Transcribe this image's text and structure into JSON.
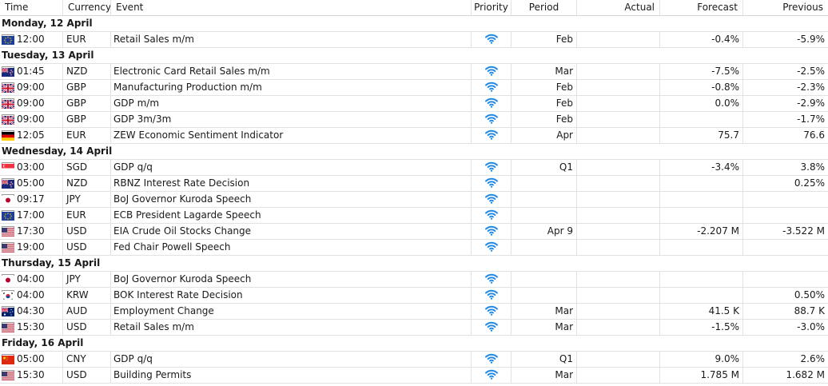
{
  "columns": {
    "time": "Time",
    "currency": "Currency",
    "event": "Event",
    "priority": "Priority",
    "period": "Period",
    "actual": "Actual",
    "forecast": "Forecast",
    "previous": "Previous"
  },
  "icon": "wifi-signal-priority-icon",
  "priority_color": "#1e88e5",
  "days": [
    {
      "label": "Monday, 12 April",
      "events": [
        {
          "time": "12:00",
          "flag": "eu",
          "currency": "EUR",
          "event": "Retail Sales m/m",
          "period": "Feb",
          "actual": "",
          "forecast": "-0.4%",
          "previous": "-5.9%"
        }
      ]
    },
    {
      "label": "Tuesday, 13 April",
      "events": [
        {
          "time": "01:45",
          "flag": "nz",
          "currency": "NZD",
          "event": "Electronic Card Retail Sales m/m",
          "period": "Mar",
          "actual": "",
          "forecast": "-7.5%",
          "previous": "-2.5%"
        },
        {
          "time": "09:00",
          "flag": "gb",
          "currency": "GBP",
          "event": "Manufacturing Production m/m",
          "period": "Feb",
          "actual": "",
          "forecast": "-0.8%",
          "previous": "-2.3%"
        },
        {
          "time": "09:00",
          "flag": "gb",
          "currency": "GBP",
          "event": "GDP m/m",
          "period": "Feb",
          "actual": "",
          "forecast": "0.0%",
          "previous": "-2.9%"
        },
        {
          "time": "09:00",
          "flag": "gb",
          "currency": "GBP",
          "event": "GDP 3m/3m",
          "period": "Feb",
          "actual": "",
          "forecast": "",
          "previous": "-1.7%"
        },
        {
          "time": "12:05",
          "flag": "de",
          "currency": "EUR",
          "event": "ZEW Economic Sentiment Indicator",
          "period": "Apr",
          "actual": "",
          "forecast": "75.7",
          "previous": "76.6"
        }
      ]
    },
    {
      "label": "Wednesday, 14 April",
      "events": [
        {
          "time": "03:00",
          "flag": "sg",
          "currency": "SGD",
          "event": "GDP q/q",
          "period": "Q1",
          "actual": "",
          "forecast": "-3.4%",
          "previous": "3.8%"
        },
        {
          "time": "05:00",
          "flag": "nz",
          "currency": "NZD",
          "event": "RBNZ Interest Rate Decision",
          "period": "",
          "actual": "",
          "forecast": "",
          "previous": "0.25%"
        },
        {
          "time": "09:17",
          "flag": "jp",
          "currency": "JPY",
          "event": "BoJ Governor Kuroda Speech",
          "period": "",
          "actual": "",
          "forecast": "",
          "previous": ""
        },
        {
          "time": "17:00",
          "flag": "eu",
          "currency": "EUR",
          "event": "ECB President Lagarde Speech",
          "period": "",
          "actual": "",
          "forecast": "",
          "previous": ""
        },
        {
          "time": "17:30",
          "flag": "us",
          "currency": "USD",
          "event": "EIA Crude Oil Stocks Change",
          "period": "Apr 9",
          "actual": "",
          "forecast": "-2.207 M",
          "previous": "-3.522 M"
        },
        {
          "time": "19:00",
          "flag": "us",
          "currency": "USD",
          "event": "Fed Chair Powell Speech",
          "period": "",
          "actual": "",
          "forecast": "",
          "previous": ""
        }
      ]
    },
    {
      "label": "Thursday, 15 April",
      "events": [
        {
          "time": "04:00",
          "flag": "jp",
          "currency": "JPY",
          "event": "BoJ Governor Kuroda Speech",
          "period": "",
          "actual": "",
          "forecast": "",
          "previous": ""
        },
        {
          "time": "04:00",
          "flag": "kr",
          "currency": "KRW",
          "event": "BOK Interest Rate Decision",
          "period": "",
          "actual": "",
          "forecast": "",
          "previous": "0.50%"
        },
        {
          "time": "04:30",
          "flag": "au",
          "currency": "AUD",
          "event": "Employment Change",
          "period": "Mar",
          "actual": "",
          "forecast": "41.5 K",
          "previous": "88.7 K"
        },
        {
          "time": "15:30",
          "flag": "us",
          "currency": "USD",
          "event": "Retail Sales m/m",
          "period": "Mar",
          "actual": "",
          "forecast": "-1.5%",
          "previous": "-3.0%"
        }
      ]
    },
    {
      "label": "Friday, 16 April",
      "events": [
        {
          "time": "05:00",
          "flag": "cn",
          "currency": "CNY",
          "event": "GDP q/q",
          "period": "Q1",
          "actual": "",
          "forecast": "9.0%",
          "previous": "2.6%"
        },
        {
          "time": "15:30",
          "flag": "us",
          "currency": "USD",
          "event": "Building Permits",
          "period": "Mar",
          "actual": "",
          "forecast": "1.785 M",
          "previous": "1.682 M"
        }
      ]
    }
  ]
}
